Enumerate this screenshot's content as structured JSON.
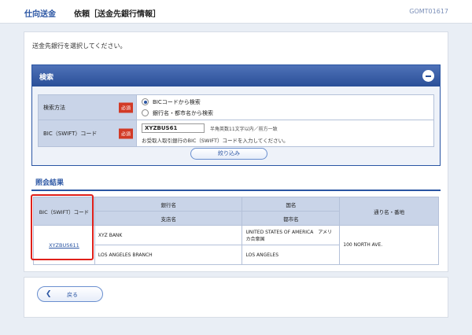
{
  "header": {
    "section": "仕向送金",
    "title": "依頼［送金先銀行情報］",
    "screen_code": "GOMT01617"
  },
  "instruction": "送金先銀行を選択してください。",
  "search": {
    "label": "検索",
    "method_label": "検索方法",
    "required_label": "必須",
    "options": [
      "BICコードから検索",
      "銀行名・都市名から検索"
    ],
    "selected_option": "BICコードから検索",
    "bic_label": "BIC（SWIFT）コード",
    "bic_value": "XYZBUS61",
    "bic_hint": "半角英数11文字以内／前方一致",
    "bic_note": "お受取人取引銀行のBIC（SWIFT）コードを入力してください。",
    "narrow_button": "絞り込み"
  },
  "results": {
    "title": "照会結果",
    "headers": {
      "bic": "BIC（SWIFT）コード",
      "bank_name": "銀行名",
      "branch_name": "支店名",
      "country": "国名",
      "city": "都市名",
      "street": "通り名・番地"
    },
    "rows": [
      {
        "bic": "XYZBUS611",
        "bank_name": "XYZ BANK",
        "branch_name": "LOS ANGELES BRANCH",
        "country": "UNITED STATES OF AMERICA　アメリカ合衆国",
        "city": "LOS ANGELES",
        "street": "100 NORTH AVE."
      }
    ]
  },
  "back_button": "戻る",
  "colors": {
    "accent": "#2a55a3",
    "required": "#d23a26",
    "highlight": "#e0201a"
  }
}
